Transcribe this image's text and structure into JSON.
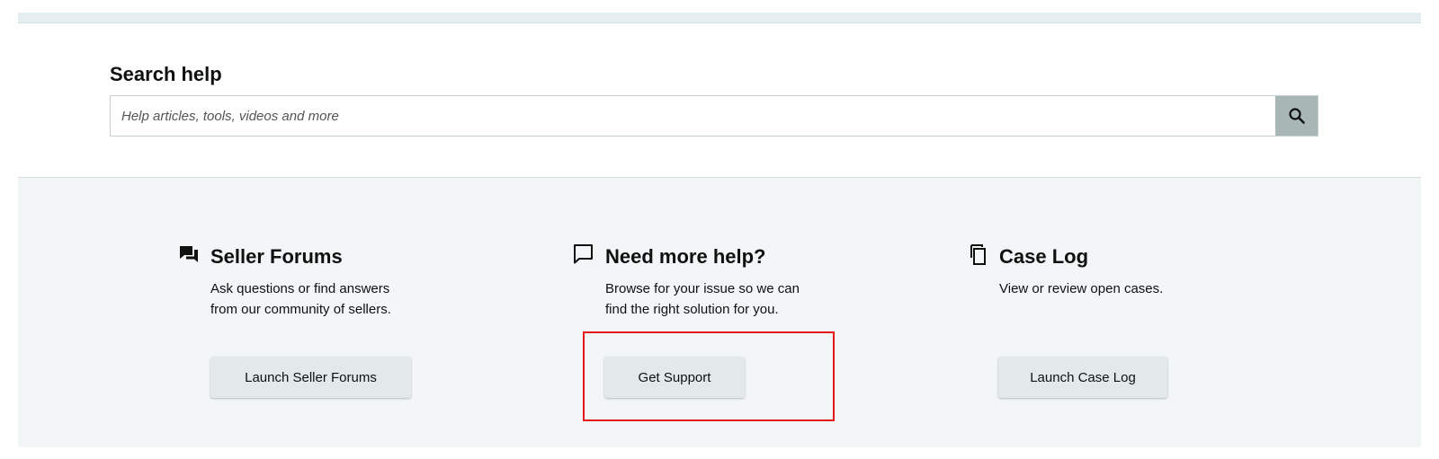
{
  "search": {
    "title": "Search help",
    "placeholder": "Help articles, tools, videos and more",
    "button_icon": "search-icon"
  },
  "cards": [
    {
      "icon": "forum-icon",
      "title": "Seller Forums",
      "description_line1": "Ask questions or find answers",
      "description_line2": "from our community of sellers.",
      "button_label": "Launch Seller Forums"
    },
    {
      "icon": "chat-bubble-icon",
      "title": "Need more help?",
      "description_line1": "Browse for your issue so we can",
      "description_line2": "find the right solution for you.",
      "button_label": "Get Support"
    },
    {
      "icon": "copy-icon",
      "title": "Case Log",
      "description_line1": "View or review open cases.",
      "description_line2": "",
      "button_label": "Launch Case Log"
    }
  ],
  "colors": {
    "panel_background": "#f2f6f7",
    "button_background": "#e3e9ea",
    "search_button": "#a9b6b6",
    "highlight": "#e4161b"
  }
}
